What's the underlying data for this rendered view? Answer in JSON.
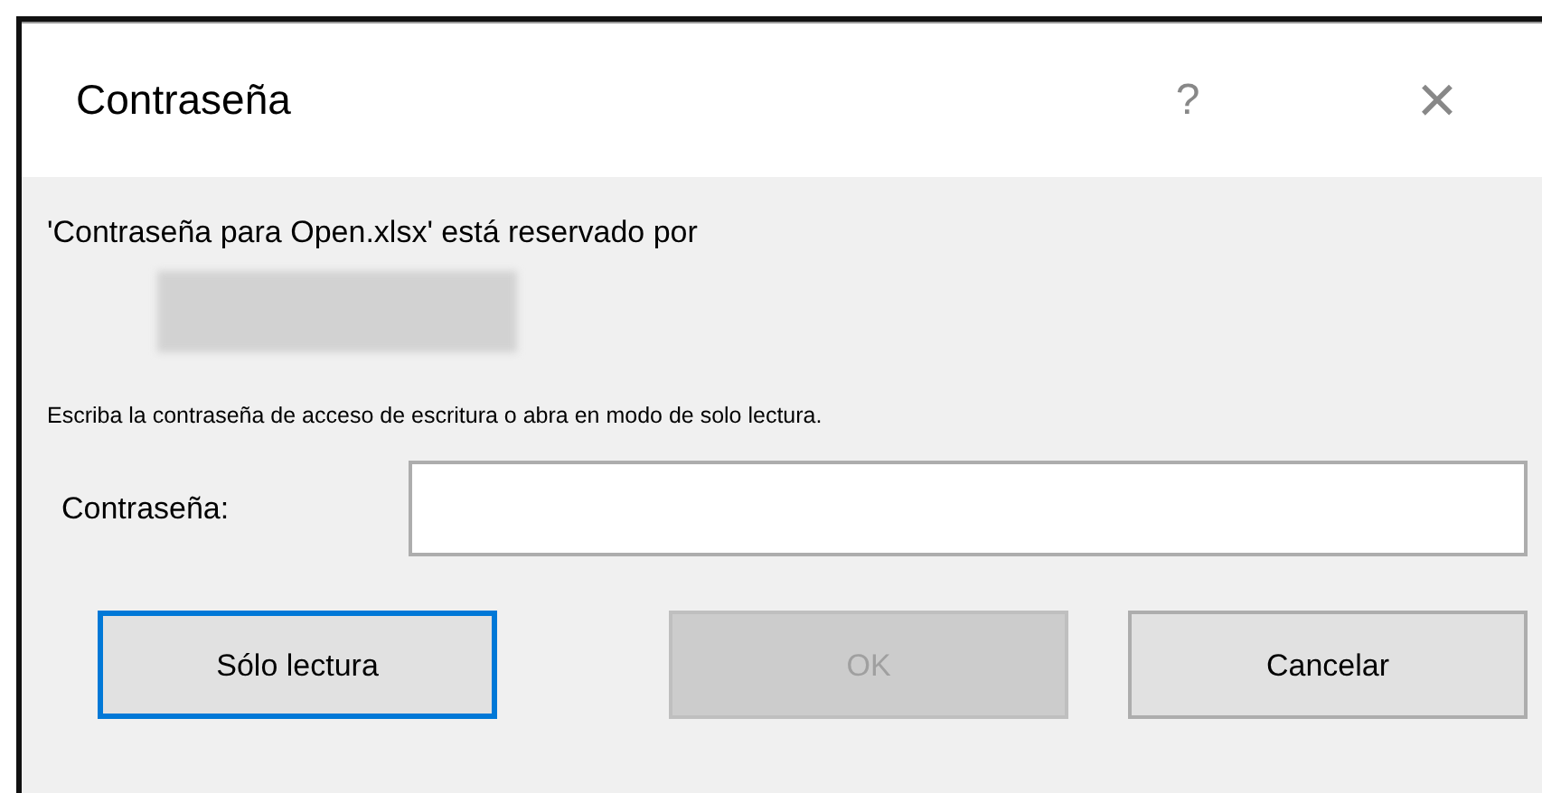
{
  "window": {
    "title": "Contraseña",
    "help_glyph": "?",
    "close_glyph": "×"
  },
  "message": "'Contraseña para Open.xlsx' está reservado por",
  "instruction": "Escriba la contraseña de acceso de escritura o abra en modo de solo lectura.",
  "password_field": {
    "label": "Contraseña:"
  },
  "buttons": [
    {
      "label": "Sólo lectura",
      "focused": true,
      "disabled": false
    },
    {
      "label": "OK",
      "focused": false,
      "disabled": true
    },
    {
      "label": "Cancelar",
      "focused": false,
      "disabled": false
    }
  ]
}
